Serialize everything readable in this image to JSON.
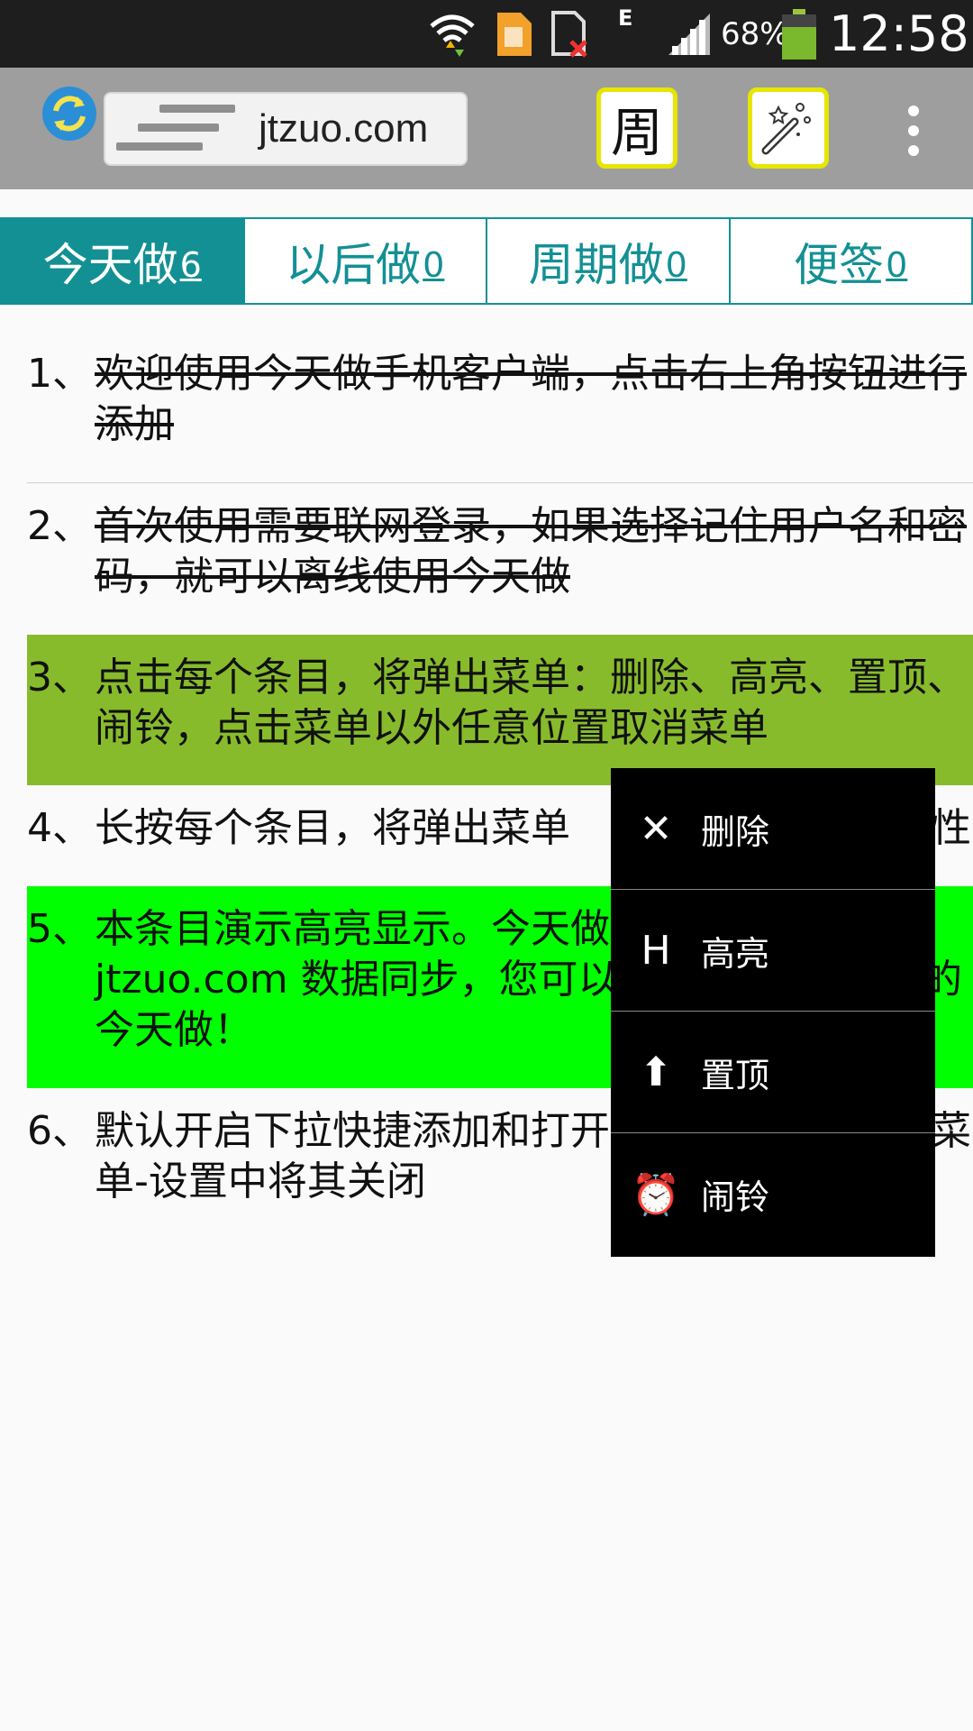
{
  "status_bar": {
    "battery": "68%",
    "network": "E",
    "time": "12:58"
  },
  "action_bar": {
    "logo_text": "jtzuo.com",
    "week_button": "周",
    "icons": [
      "sync-icon",
      "magic-wand-icon",
      "overflow-menu-icon"
    ]
  },
  "tabs": [
    {
      "label": "今天做",
      "count": "6"
    },
    {
      "label": "以后做",
      "count": "0"
    },
    {
      "label": "周期做",
      "count": "0"
    },
    {
      "label": "便签",
      "count": "0"
    }
  ],
  "items": [
    {
      "num": "1、",
      "text": "欢迎使用今天做手机客户端，点击右上角按钮进行添加"
    },
    {
      "num": "2、",
      "text": "首次使用需要联网登录，如果选择记住用户名和密码，就可以离线使用今天做"
    },
    {
      "num": "3、",
      "text": "点击每个条目，将弹出菜单：删除、高亮、置顶、闹铃，点击菜单以外任意位置取消菜单"
    },
    {
      "num": "4、",
      "text": "长按每个条目，将弹出菜单"
    },
    {
      "num": "4b",
      "text": "性"
    },
    {
      "num": "5、",
      "text": "本条目演示高亮显示。今天做"
    },
    {
      "num": "5b",
      "text": "jtzuo.com 数据同步，您可以"
    },
    {
      "num": "5c",
      "text": "的"
    },
    {
      "num": "5d",
      "text": "今天做！"
    },
    {
      "num": "6、",
      "text": "默认开启下拉快捷添加和打开"
    },
    {
      "num": "6b",
      "text": "菜"
    },
    {
      "num": "6c",
      "text": "单-设置中将其关闭"
    }
  ],
  "menu": [
    {
      "icon": "close-icon",
      "glyph": "✕",
      "label": "删除"
    },
    {
      "icon": "highlight-icon",
      "glyph": "H",
      "label": "高亮"
    },
    {
      "icon": "pin-top-icon",
      "glyph": "⬆",
      "label": "置顶"
    },
    {
      "icon": "alarm-icon",
      "glyph": "⏰",
      "label": "闹铃"
    }
  ],
  "colors": {
    "accent": "#139094",
    "highlight_olive": "#87bb2c",
    "highlight_green": "#00ff00"
  }
}
